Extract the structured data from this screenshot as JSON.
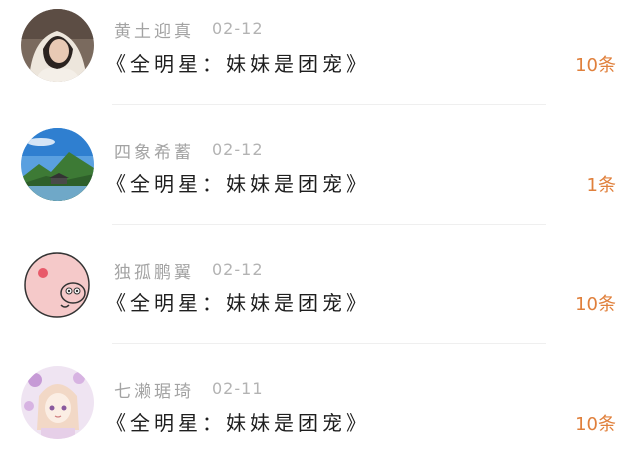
{
  "comments": [
    {
      "username": "黄土迎真",
      "date": "02-12",
      "title": "《全明星：妹妹是团宠》",
      "count": "10条",
      "avatar_icon": "girl-photo-avatar"
    },
    {
      "username": "四象希蓄",
      "date": "02-12",
      "title": "《全明星：妹妹是团宠》",
      "count": "1条",
      "avatar_icon": "landscape-avatar"
    },
    {
      "username": "独孤鹏翼",
      "date": "02-12",
      "title": "《全明星：妹妹是团宠》",
      "count": "10条",
      "avatar_icon": "cartoon-pig-avatar"
    },
    {
      "username": "七濑琚琦",
      "date": "02-11",
      "title": "《全明星：妹妹是团宠》",
      "count": "10条",
      "avatar_icon": "anime-girl-avatar"
    }
  ],
  "colors": {
    "count": "#e0803c",
    "username": "#a3a3a3",
    "date": "#b3b3b3",
    "title": "#1e1e1e",
    "divider": "#efefef"
  }
}
